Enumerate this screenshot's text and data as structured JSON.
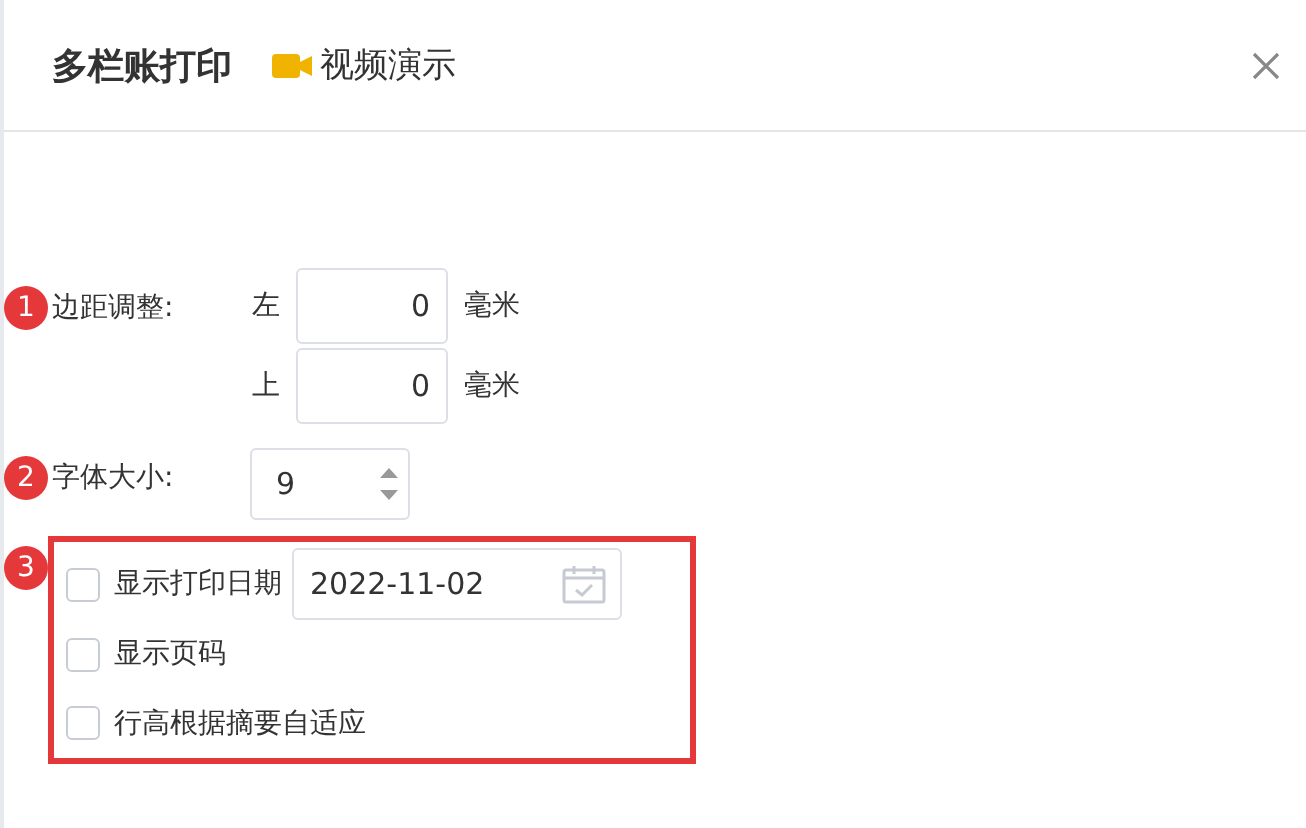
{
  "dialog": {
    "title": "多栏账打印",
    "video_link": "视频演示"
  },
  "margin": {
    "step": "1",
    "label": "边距调整:",
    "fields": [
      {
        "side": "左",
        "value": "0",
        "unit": "毫米"
      },
      {
        "side": "上",
        "value": "0",
        "unit": "毫米"
      }
    ]
  },
  "font_size": {
    "step": "2",
    "label": "字体大小:",
    "value": "9"
  },
  "options": {
    "step": "3",
    "items": [
      {
        "kind": "date",
        "label": "显示打印日期",
        "checked": false,
        "date": "2022-11-02"
      },
      {
        "kind": "plain",
        "label": "显示页码",
        "checked": false
      },
      {
        "kind": "plain",
        "label": "行高根据摘要自适应",
        "checked": false
      }
    ]
  }
}
